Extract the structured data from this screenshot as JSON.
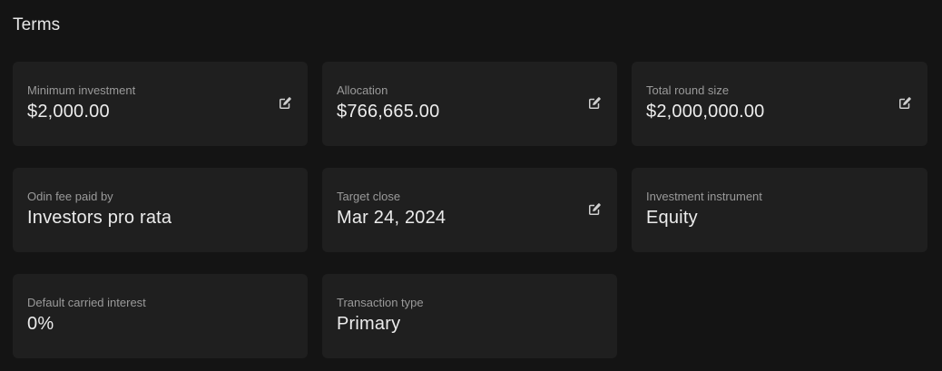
{
  "section": {
    "title": "Terms"
  },
  "colors": {
    "background": "#141414",
    "card": "#1f1f1f",
    "label": "#9a9a9a",
    "value": "#ececec",
    "icon": "#cfcfcf"
  },
  "terms": [
    {
      "label": "Minimum investment",
      "value": "$2,000.00",
      "editable": true,
      "icon": "edit-icon"
    },
    {
      "label": "Allocation",
      "value": "$766,665.00",
      "editable": true,
      "icon": "edit-icon"
    },
    {
      "label": "Total round size",
      "value": "$2,000,000.00",
      "editable": true,
      "icon": "edit-icon"
    },
    {
      "label": "Odin fee paid by",
      "value": "Investors pro rata",
      "editable": false
    },
    {
      "label": "Target close",
      "value": "Mar 24, 2024",
      "editable": true,
      "icon": "edit-icon"
    },
    {
      "label": "Investment instrument",
      "value": "Equity",
      "editable": false
    },
    {
      "label": "Default carried interest",
      "value": "0%",
      "editable": false
    },
    {
      "label": "Transaction type",
      "value": "Primary",
      "editable": false
    }
  ]
}
